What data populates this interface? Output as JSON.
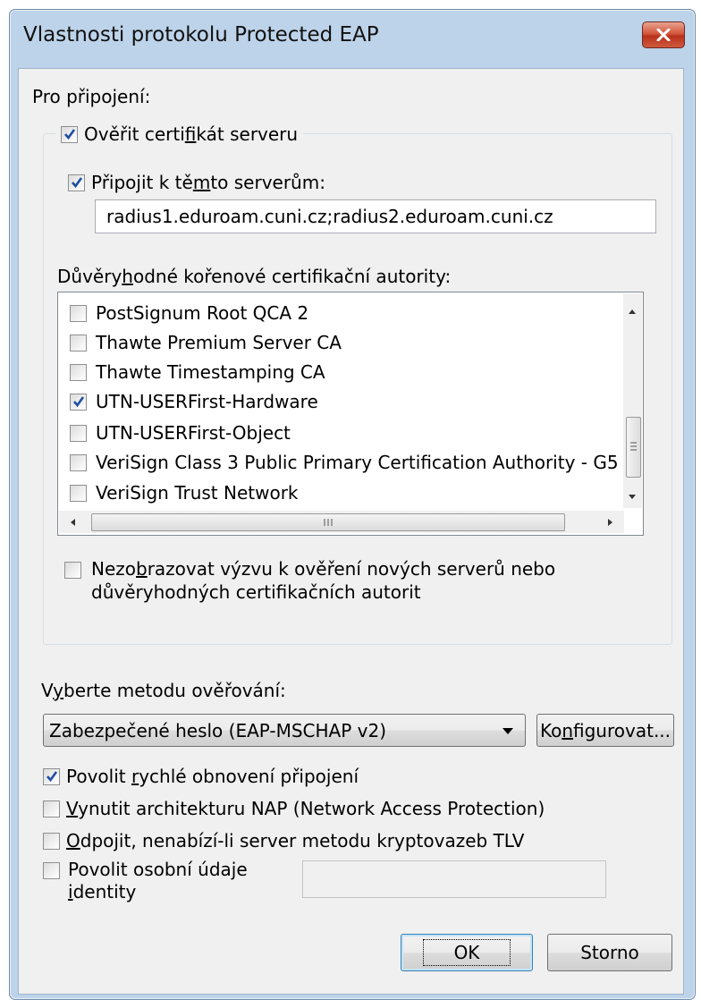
{
  "window": {
    "title": "Vlastnosti protokolu Protected EAP",
    "close_glyph": "✕"
  },
  "connection_label": "Pro připojení:",
  "verify_cert": {
    "label_pre": "Ověřit certi",
    "label_u": "f",
    "label_post": "ikát serveru",
    "checked": true
  },
  "connect_servers": {
    "label_pre": "Připojit k tě",
    "label_u": "m",
    "label_post": "to serverům:",
    "checked": true,
    "value": "radius1.eduroam.cuni.cz;radius2.eduroam.cuni.cz"
  },
  "trusted_ca": {
    "label_pre": "Důvěry",
    "label_u": "h",
    "label_post": "odné kořenové certifikační autority:",
    "items": [
      {
        "label": "PostSignum Root QCA 2",
        "checked": false
      },
      {
        "label": "Thawte Premium Server CA",
        "checked": false
      },
      {
        "label": "Thawte Timestamping CA",
        "checked": false
      },
      {
        "label": "UTN-USERFirst-Hardware",
        "checked": true
      },
      {
        "label": "UTN-USERFirst-Object",
        "checked": false
      },
      {
        "label": "VeriSign Class 3 Public Primary Certification Authority - G5",
        "checked": false
      },
      {
        "label": "VeriSign Trust Network",
        "checked": false
      }
    ]
  },
  "no_prompt": {
    "line1_pre": "Nezo",
    "line1_u": "b",
    "line1_post": "razovat výzvu k ověření nových serverů nebo",
    "line2": "důvěryhodných certifikačních autorit",
    "checked": false
  },
  "auth_method": {
    "label_pre": "V",
    "label_u": "y",
    "label_post": "berte metodu ověřování:",
    "selected": "Zabezpečené heslo (EAP-MSCHAP v2)",
    "configure_pre": "Ko",
    "configure_u": "n",
    "configure_post": "figurovat..."
  },
  "options": {
    "fast_reconnect": {
      "pre": "Povolit ",
      "u": "r",
      "post": "ychlé obnovení připojení",
      "checked": true
    },
    "nap": {
      "pre": "",
      "u": "V",
      "post": "ynutit architekturu NAP (Network Access Protection)",
      "checked": false
    },
    "disconnect": {
      "pre": "",
      "u": "O",
      "post": "dpojit, nenabízí-li server metodu kryptovazeb TLV",
      "checked": false
    },
    "identity_privacy": {
      "line1": "Povolit osobní údaje",
      "line2_u": "i",
      "line2_post": "dentity",
      "checked": false,
      "value": ""
    }
  },
  "buttons": {
    "ok": "OK",
    "cancel": "Storno"
  },
  "colors": {
    "frame": "#bdd3ea",
    "client": "#f0f0f0",
    "check": "#1e4fa0"
  }
}
